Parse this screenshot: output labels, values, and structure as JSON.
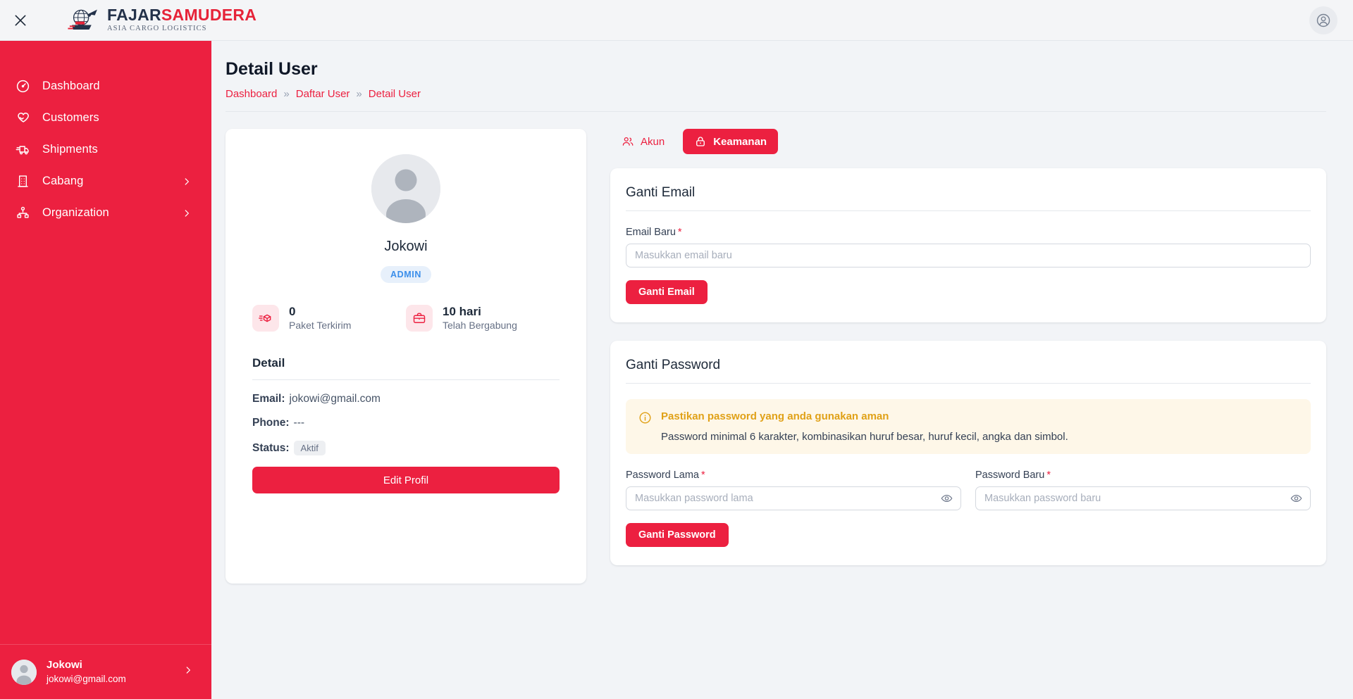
{
  "brand": {
    "title_part1": "FAJAR",
    "title_part2": "SAMUDERA",
    "subtitle": "ASIA CARGO LOGISTICS",
    "close_label": "Close",
    "accent_color": "#EC2040",
    "navy_color": "#24324A"
  },
  "sidebar": {
    "items": [
      {
        "label": "Dashboard",
        "icon": "gauge-icon",
        "has_chevron": false
      },
      {
        "label": "Customers",
        "icon": "handshake-icon",
        "has_chevron": false
      },
      {
        "label": "Shipments",
        "icon": "truck-icon",
        "has_chevron": false
      },
      {
        "label": "Cabang",
        "icon": "building-icon",
        "has_chevron": true
      },
      {
        "label": "Organization",
        "icon": "org-chart-icon",
        "has_chevron": true
      }
    ],
    "user": {
      "name": "Jokowi",
      "email": "jokowi@gmail.com"
    }
  },
  "header": {
    "page_title": "Detail User",
    "breadcrumb": [
      {
        "label": "Dashboard"
      },
      {
        "label": "Daftar User"
      },
      {
        "label": "Detail User"
      }
    ],
    "breadcrumb_separator": "»"
  },
  "profile": {
    "name": "Jokowi",
    "role_badge": "ADMIN",
    "stats": [
      {
        "value": "0",
        "label": "Paket Terkirim",
        "icon": "package-send-icon"
      },
      {
        "value": "10 hari",
        "label": "Telah Bergabung",
        "icon": "briefcase-icon"
      }
    ],
    "detail_title": "Detail",
    "rows": [
      {
        "key": "Email:",
        "value": "jokowi@gmail.com",
        "badge": false
      },
      {
        "key": "Phone:",
        "value": "---",
        "badge": false
      },
      {
        "key": "Status:",
        "value": "Aktif",
        "badge": true
      }
    ],
    "edit_button": "Edit Profil"
  },
  "tabs": [
    {
      "label": "Akun",
      "icon": "users-icon",
      "active": false
    },
    {
      "label": "Keamanan",
      "icon": "lock-icon",
      "active": true
    }
  ],
  "email_panel": {
    "title": "Ganti Email",
    "field_label": "Email Baru",
    "required_mark": "*",
    "placeholder": "Masukkan email baru",
    "value": "",
    "submit_label": "Ganti Email"
  },
  "password_panel": {
    "title": "Ganti Password",
    "alert": {
      "icon": "info-circle-icon",
      "title": "Pastikan password yang anda gunakan aman",
      "body": "Password minimal 6 karakter, kombinasikan huruf besar, huruf kecil, angka dan simbol."
    },
    "old_password": {
      "label": "Password Lama",
      "required_mark": "*",
      "placeholder": "Masukkan password lama",
      "value": ""
    },
    "new_password": {
      "label": "Password Baru",
      "required_mark": "*",
      "placeholder": "Masukkan password baru",
      "value": ""
    },
    "submit_label": "Ganti Password"
  }
}
